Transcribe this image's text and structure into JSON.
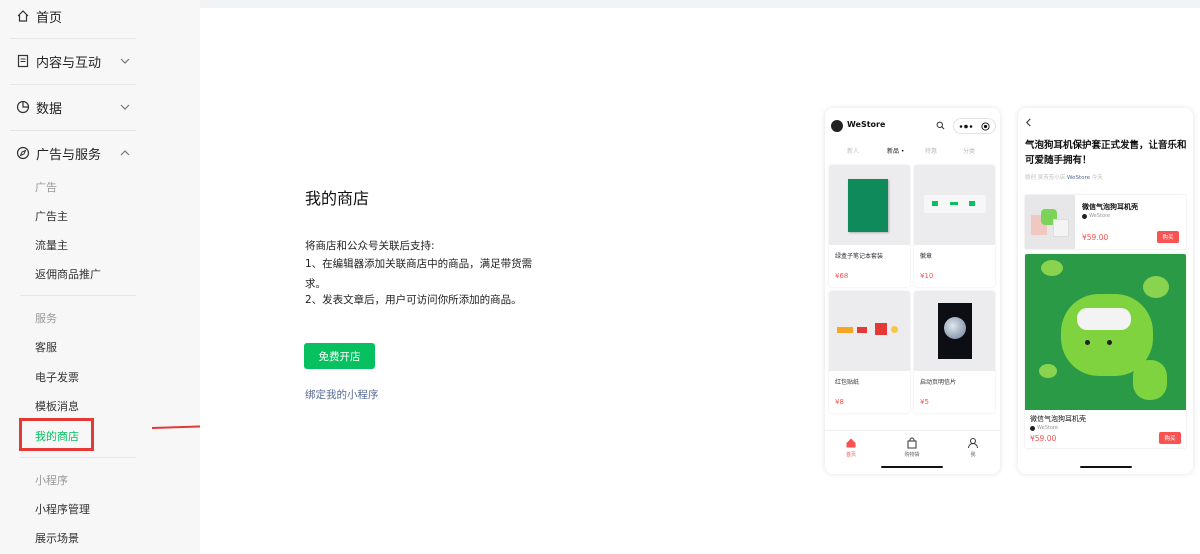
{
  "sidebar": {
    "home": "首页",
    "content": "内容与互动",
    "data": "数据",
    "ads_services": "广告与服务",
    "group_ads": "广告",
    "advertiser": "广告主",
    "publisher": "流量主",
    "rebate": "返佣商品推广",
    "group_services": "服务",
    "customer_service": "客服",
    "invoice": "电子发票",
    "template_msg": "模板消息",
    "my_store": "我的商店",
    "group_miniprogram": "小程序",
    "mp_manage": "小程序管理",
    "showcase": "展示场景"
  },
  "main": {
    "title": "我的商店",
    "intro": "将商店和公众号关联后支持:",
    "point1": "1、在编辑器添加关联商店中的商品，满足带货需求。",
    "point2": "2、发表文章后，用户可访问你所添加的商品。",
    "open_button": "免费开店",
    "bind_link": "绑定我的小程序"
  },
  "preview_store": {
    "name": "WeStore",
    "tabs": [
      "新人",
      "新品",
      "特惠",
      "分类"
    ],
    "current_tab": 1,
    "products": [
      {
        "name": "绿盒子笔记本套装",
        "price": "¥68"
      },
      {
        "name": "徽章",
        "price": "¥10"
      },
      {
        "name": "红包贴纸",
        "price": "¥8"
      },
      {
        "name": "启动页明信片",
        "price": "¥5"
      }
    ],
    "nav": {
      "home": "首页",
      "cart": "购物袋",
      "me": "我"
    }
  },
  "preview_article": {
    "title": "气泡狗耳机保护套正式发售，让音乐和可爱随手拥有！",
    "meta_prefix": "原创  吴芳芳小店",
    "meta_account": "WeStore",
    "meta_time": "今天",
    "product_name": "微信气泡狗耳机壳",
    "store_name": "WeStore",
    "price": "¥59.00",
    "buy_label": "购买"
  },
  "colors": {
    "accent": "#07c160",
    "price": "#fa5151",
    "link": "#576b95",
    "highlight_box": "#e53935"
  }
}
